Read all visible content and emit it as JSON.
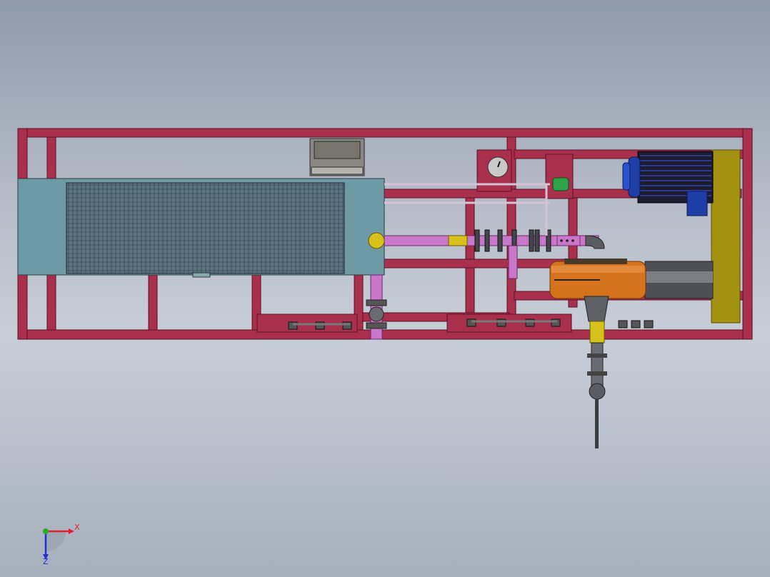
{
  "triad": {
    "x_label": "X",
    "y_label": "",
    "z_label": "Z"
  },
  "colors": {
    "background_top": "#8f9aab",
    "background_bottom": "#c8ced7",
    "frame": "#a8304d",
    "frame_edge": "#5a1024",
    "radiator_panel": "#6e9aa6",
    "pipe_pink": "#c977c9",
    "fitting_yellow": "#d6c21a",
    "tank_orange": "#d5731c",
    "motor_blue": "#1f3fa8",
    "coupling_gray": "#4d4f55",
    "motor_mount_olive": "#a39212",
    "valve_green": "#2fa34a",
    "axis_x": "#e0202a",
    "axis_y": "#22b022",
    "axis_z": "#2030d0"
  },
  "components": [
    "base-frame",
    "radiator-core",
    "control-box",
    "gauge-plate",
    "motor",
    "motor-mount-plate",
    "coupling-guard",
    "oil-tank",
    "suction-line",
    "discharge-line",
    "flow-valve",
    "mounting-rails"
  ]
}
